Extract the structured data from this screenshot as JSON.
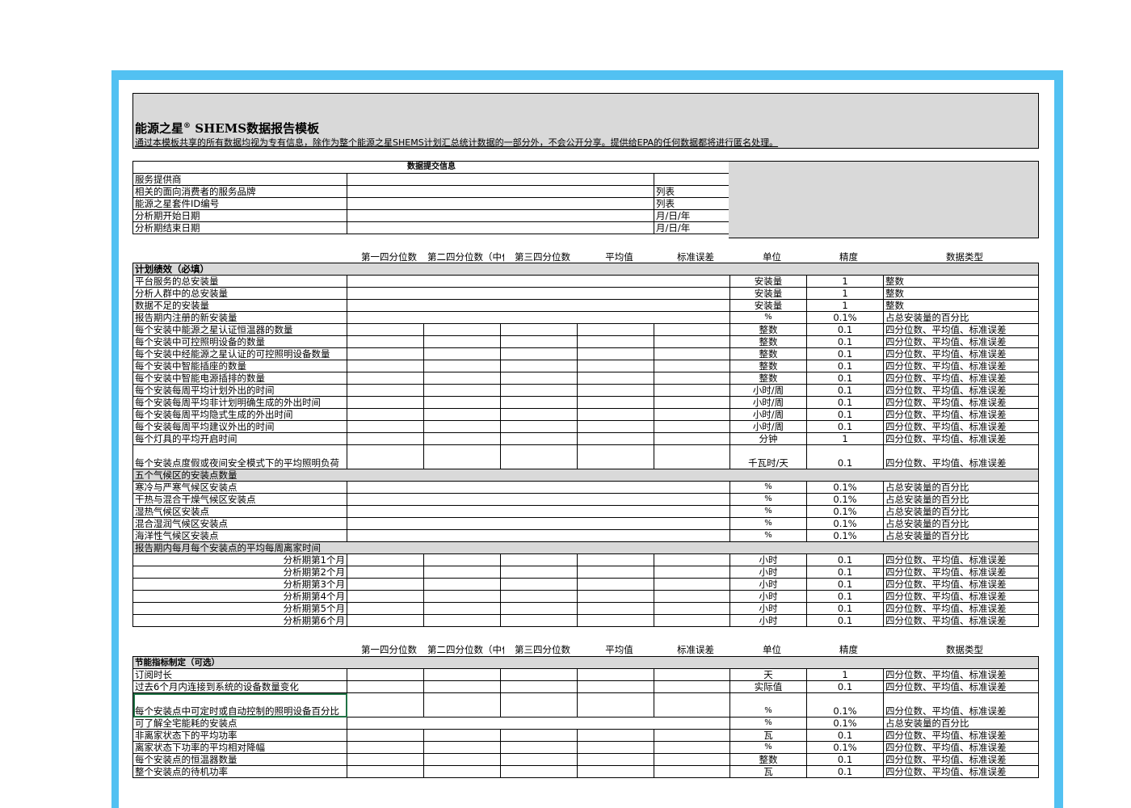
{
  "header": {
    "title_prefix": "能源之星",
    "title_sup": "®",
    "title_main": " SHEMS数据报告模板",
    "note": "通过本模板共享的所有数据均视为专有信息，除作为整个能源之星SHEMS计划汇总统计数据的一部分外，不会公开分享。提供给EPA的任何数据都将进行匿名处理。"
  },
  "submission": {
    "heading": "数据提交信息",
    "rows": [
      {
        "label": "服务提供商",
        "hint": ""
      },
      {
        "label": "相关的面向消费者的服务品牌",
        "hint": "列表"
      },
      {
        "label": "能源之星套件ID编号",
        "hint": "列表"
      },
      {
        "label": "分析期开始日期",
        "hint": "月/日/年"
      },
      {
        "label": "分析期结束日期",
        "hint": "月/日/年"
      }
    ]
  },
  "columns": {
    "q1": "第一四分位数",
    "q2": "第二四分位数（中位数）",
    "q3": "第三四分位数",
    "mean": "平均值",
    "se": "标准误差",
    "unit": "单位",
    "precision": "精度",
    "dtype": "数据类型"
  },
  "required": {
    "heading": "计划绩效（必填）",
    "rows": [
      {
        "label": "平台服务的总安装量",
        "unit": "安装量",
        "precision": "1",
        "dtype": "整数",
        "merged": true
      },
      {
        "label": "分析人群中的总安装量",
        "unit": "安装量",
        "precision": "1",
        "dtype": "整数",
        "merged": true
      },
      {
        "label": "数据不足的安装量",
        "unit": "安装量",
        "precision": "1",
        "dtype": "整数",
        "merged": true
      },
      {
        "label": "报告期内注册的新安装量",
        "unit": "%",
        "precision": "0.1%",
        "dtype": "占总安装量的百分比",
        "merged": true
      },
      {
        "label": "每个安装中能源之星认证恒温器的数量",
        "unit": "整数",
        "precision": "0.1",
        "dtype": "四分位数、平均值、标准误差"
      },
      {
        "label": "每个安装中可控照明设备的数量",
        "unit": "整数",
        "precision": "0.1",
        "dtype": "四分位数、平均值、标准误差"
      },
      {
        "label": "每个安装中经能源之星认证的可控照明设备数量",
        "unit": "整数",
        "precision": "0.1",
        "dtype": "四分位数、平均值、标准误差"
      },
      {
        "label": "每个安装中智能插座的数量",
        "unit": "整数",
        "precision": "0.1",
        "dtype": "四分位数、平均值、标准误差"
      },
      {
        "label": "每个安装中智能电源插排的数量",
        "unit": "整数",
        "precision": "0.1",
        "dtype": "四分位数、平均值、标准误差"
      },
      {
        "label": "每个安装每周平均计划外出的时间",
        "unit": "小时/周",
        "precision": "0.1",
        "dtype": "四分位数、平均值、标准误差"
      },
      {
        "label": "每个安装每周平均非计划明确生成的外出时间",
        "unit": "小时/周",
        "precision": "0.1",
        "dtype": "四分位数、平均值、标准误差"
      },
      {
        "label": "每个安装每周平均隐式生成的外出时间",
        "unit": "小时/周",
        "precision": "0.1",
        "dtype": "四分位数、平均值、标准误差"
      },
      {
        "label": "每个安装每周平均建议外出的时间",
        "unit": "小时/周",
        "precision": "0.1",
        "dtype": "四分位数、平均值、标准误差"
      },
      {
        "label": "每个灯具的平均开启时间",
        "unit": "分钟",
        "precision": "1",
        "dtype": "四分位数、平均值、标准误差"
      }
    ],
    "tall_row": {
      "label": "每个安装点度假或夜间安全模式下的平均照明负荷",
      "unit": "千瓦时/天",
      "precision": "0.1",
      "dtype": "四分位数、平均值、标准误差"
    },
    "climate_heading": "五个气候区的安装点数量",
    "climate_rows": [
      {
        "label": "寒冷与严寒气候区安装点",
        "unit": "%",
        "precision": "0.1%",
        "dtype": "占总安装量的百分比"
      },
      {
        "label": "干热与混合干燥气候区安装点",
        "unit": "%",
        "precision": "0.1%",
        "dtype": "占总安装量的百分比"
      },
      {
        "label": "湿热气候区安装点",
        "unit": "%",
        "precision": "0.1%",
        "dtype": "占总安装量的百分比"
      },
      {
        "label": "混合湿润气候区安装点",
        "unit": "%",
        "precision": "0.1%",
        "dtype": "占总安装量的百分比"
      },
      {
        "label": "海洋性气候区安装点",
        "unit": "%",
        "precision": "0.1%",
        "dtype": "占总安装量的百分比"
      }
    ],
    "away_heading": "报告期内每月每个安装点的平均每周离家时间",
    "away_rows": [
      {
        "label": "分析期第1个月",
        "unit": "小时",
        "precision": "0.1",
        "dtype": "四分位数、平均值、标准误差"
      },
      {
        "label": "分析期第2个月",
        "unit": "小时",
        "precision": "0.1",
        "dtype": "四分位数、平均值、标准误差"
      },
      {
        "label": "分析期第3个月",
        "unit": "小时",
        "precision": "0.1",
        "dtype": "四分位数、平均值、标准误差"
      },
      {
        "label": "分析期第4个月",
        "unit": "小时",
        "precision": "0.1",
        "dtype": "四分位数、平均值、标准误差"
      },
      {
        "label": "分析期第5个月",
        "unit": "小时",
        "precision": "0.1",
        "dtype": "四分位数、平均值、标准误差"
      },
      {
        "label": "分析期第6个月",
        "unit": "小时",
        "precision": "0.1",
        "dtype": "四分位数、平均值、标准误差"
      }
    ]
  },
  "optional": {
    "heading": "节能指标制定（可选）",
    "rows": [
      {
        "label": "订阅时长",
        "unit": "天",
        "precision": "1",
        "dtype": "四分位数、平均值、标准误差"
      },
      {
        "label": "过去6个月内连接到系统的设备数量变化",
        "unit": "实际值",
        "precision": "0.1",
        "dtype": "四分位数、平均值、标准误差"
      }
    ],
    "tall_row": {
      "label": "每个安装点中可定时或自动控制的照明设备百分比",
      "unit": "%",
      "precision": "0.1%",
      "dtype": "四分位数、平均值、标准误差"
    },
    "rows2": [
      {
        "label": "可了解全宅能耗的安装点",
        "unit": "%",
        "precision": "0.1%",
        "dtype": "占总安装量的百分比",
        "merged": true
      },
      {
        "label": "非离家状态下的平均功率",
        "unit": "瓦",
        "precision": "0.1",
        "dtype": "四分位数、平均值、标准误差"
      },
      {
        "label": "离家状态下功率的平均相对降幅",
        "unit": "%",
        "precision": "0.1%",
        "dtype": "四分位数、平均值、标准误差"
      },
      {
        "label": "每个安装点的恒温器数量",
        "unit": "整数",
        "precision": "0.1",
        "dtype": "四分位数、平均值、标准误差"
      },
      {
        "label": "整个安装点的待机功率",
        "unit": "瓦",
        "precision": "0.1",
        "dtype": "四分位数、平均值、标准误差"
      }
    ]
  }
}
